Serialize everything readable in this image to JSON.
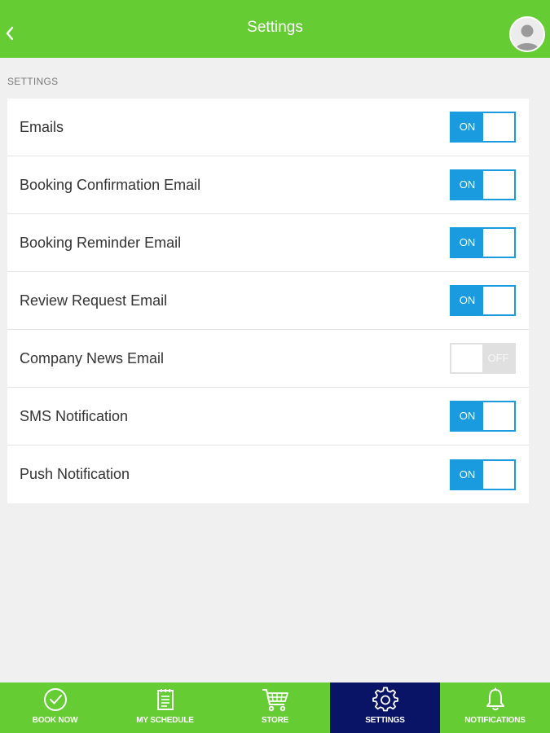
{
  "header": {
    "title": "Settings"
  },
  "section": {
    "label": "SETTINGS"
  },
  "settings": [
    {
      "label": "Emails",
      "state": "ON"
    },
    {
      "label": "Booking Confirmation Email",
      "state": "ON"
    },
    {
      "label": "Booking Reminder Email",
      "state": "ON"
    },
    {
      "label": "Review Request Email",
      "state": "ON"
    },
    {
      "label": "Company News Email",
      "state": "OFF"
    },
    {
      "label": "SMS Notification",
      "state": "ON"
    },
    {
      "label": "Push Notification",
      "state": "ON"
    }
  ],
  "tabs": [
    {
      "label": "BOOK NOW",
      "icon": "check-circle-icon"
    },
    {
      "label": "MY SCHEDULE",
      "icon": "schedule-icon"
    },
    {
      "label": "STORE",
      "icon": "cart-icon"
    },
    {
      "label": "SETTINGS",
      "icon": "gear-icon",
      "active": true
    },
    {
      "label": "NOTIFICATIONS",
      "icon": "bell-icon"
    }
  ],
  "colors": {
    "brand_green": "#66cc33",
    "toggle_on": "#1a9be0",
    "toggle_off": "#e0e0e0",
    "active_tab": "#0a1466"
  }
}
